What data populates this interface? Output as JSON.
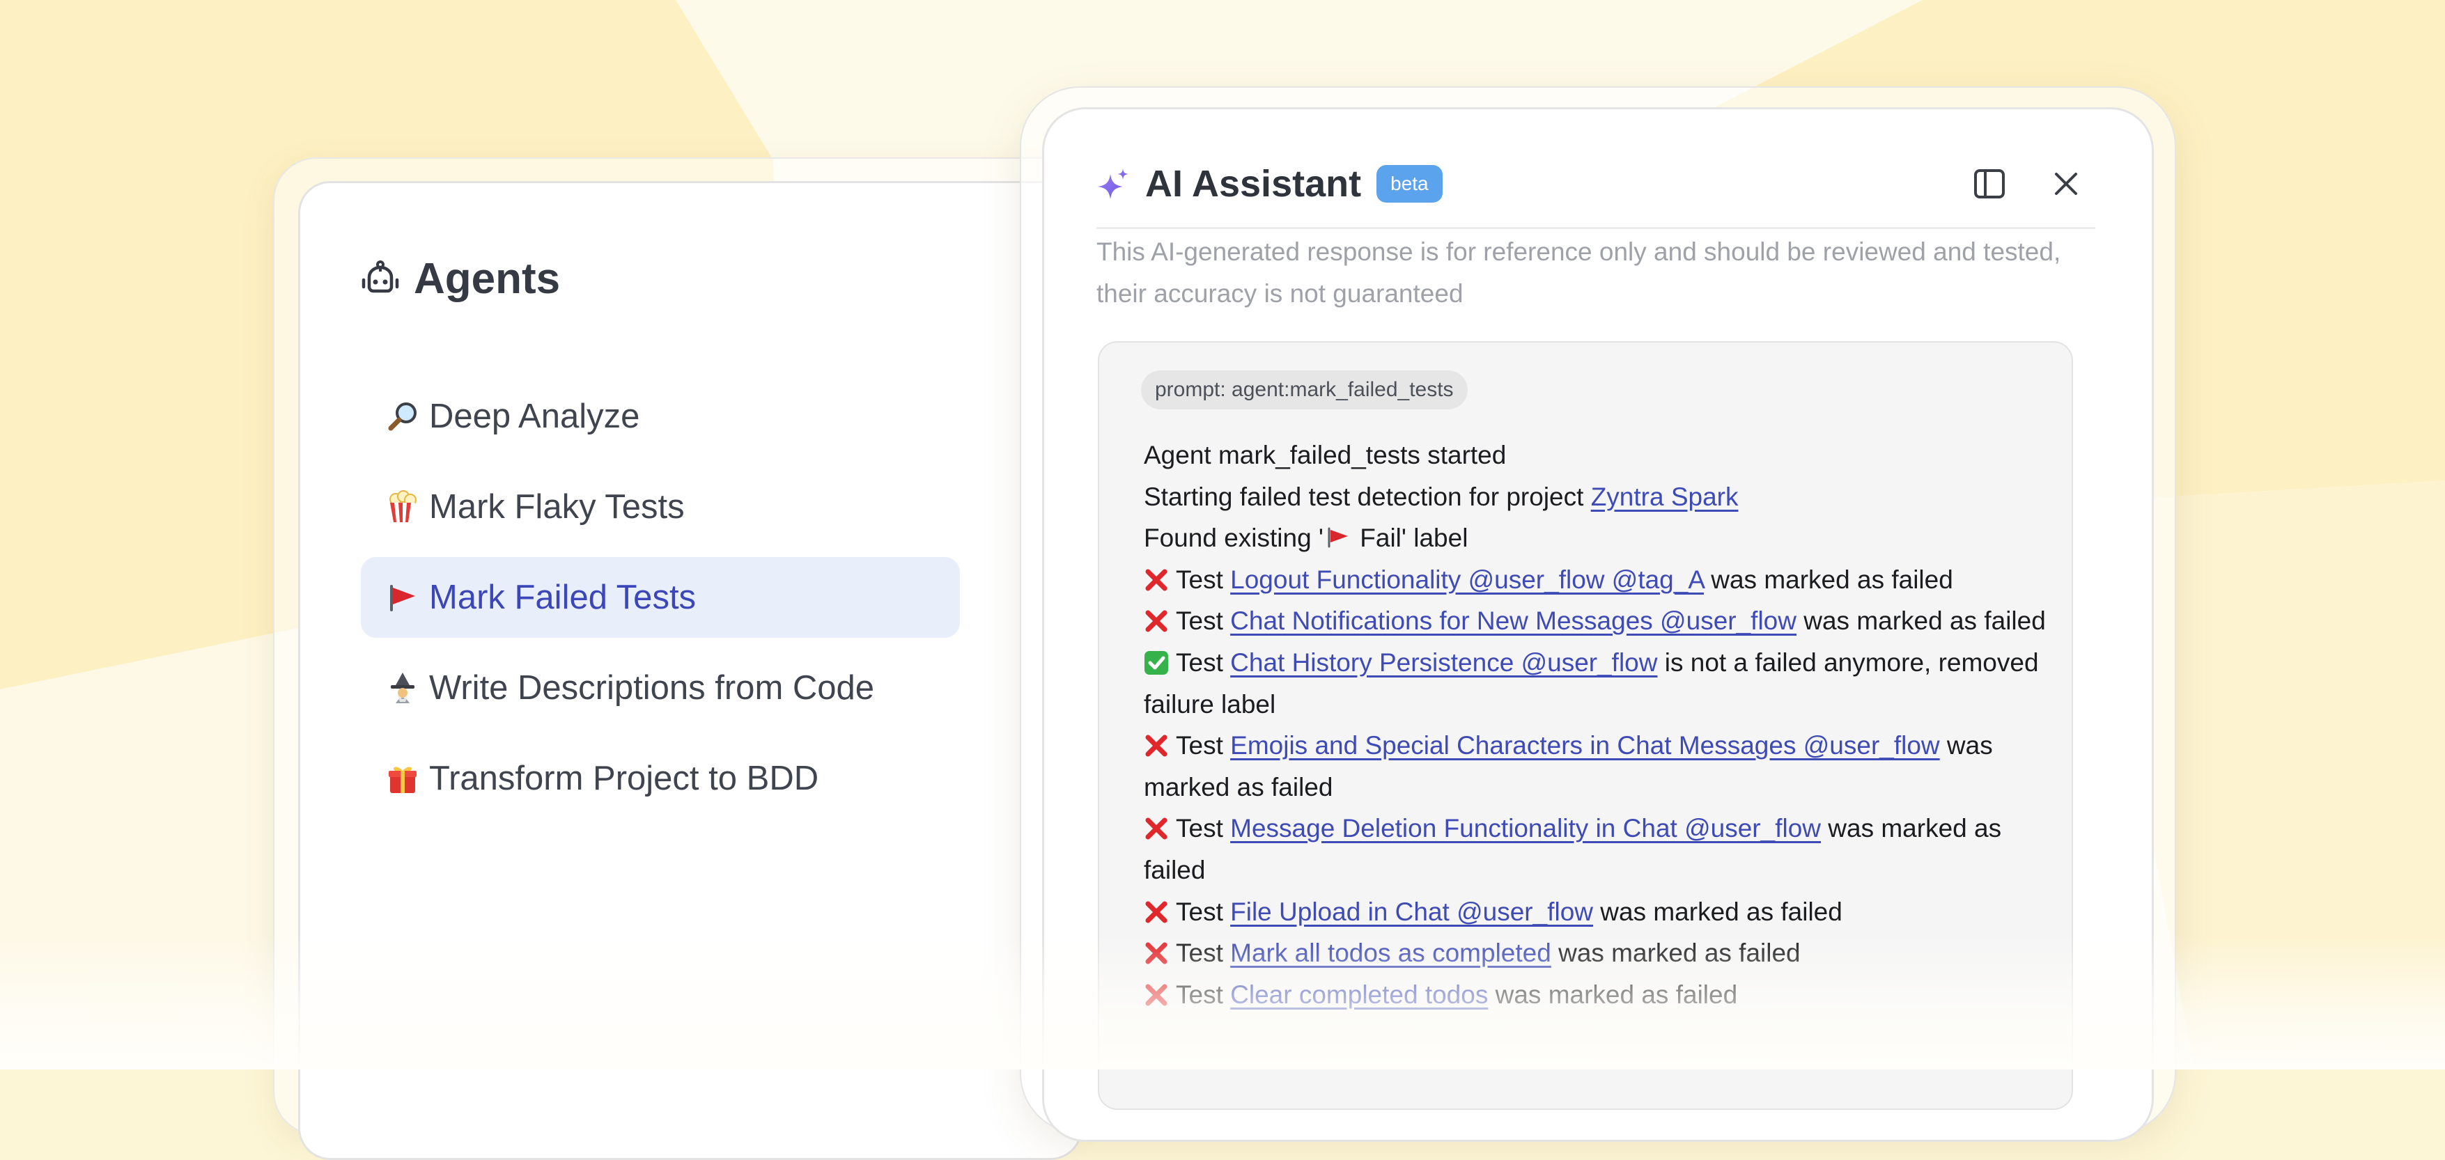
{
  "agents_panel": {
    "title": "Agents",
    "title_icon": "robot-icon",
    "items": [
      {
        "icon": "magnifier-icon",
        "label": "Deep Analyze",
        "active": false
      },
      {
        "icon": "popcorn-icon",
        "label": "Mark Flaky Tests",
        "active": false
      },
      {
        "icon": "red-flag-icon",
        "label": "Mark Failed Tests",
        "active": true
      },
      {
        "icon": "wizard-icon",
        "label": "Write Descriptions from Code",
        "active": false
      },
      {
        "icon": "gift-icon",
        "label": "Transform Project to BDD",
        "active": false
      }
    ]
  },
  "assistant": {
    "title": "AI Assistant",
    "badge": "beta",
    "title_icon": "sparkle-icon",
    "sidebar_toggle_icon": "sidebar-toggle-icon",
    "close_icon": "close-icon",
    "disclaimer": "This AI-generated response is for reference only and should be reviewed and tested, their accuracy is not guaranteed",
    "prompt_chip": "prompt: agent:mark_failed_tests",
    "log": {
      "started": "Agent mark_failed_tests started",
      "detection_prefix": "Starting failed test detection for project ",
      "project_link": "Zyntra Spark",
      "found_prefix": "Found existing '",
      "found_suffix": " Fail' label",
      "entries": [
        {
          "status": "failed",
          "prefix": "Test ",
          "link": "Logout Functionality @user_flow @tag_A",
          "suffix": " was marked as failed"
        },
        {
          "status": "failed",
          "prefix": "Test ",
          "link": "Chat Notifications for New Messages @user_flow",
          "suffix": " was marked as failed"
        },
        {
          "status": "passed",
          "prefix": "Test ",
          "link": "Chat History Persistence @user_flow",
          "suffix": " is not a failed anymore, removed failure label"
        },
        {
          "status": "failed",
          "prefix": "Test ",
          "link": "Emojis and Special Characters in Chat Messages @user_flow",
          "suffix": " was marked as failed"
        },
        {
          "status": "failed",
          "prefix": "Test ",
          "link": "Message Deletion Functionality in Chat @user_flow",
          "suffix": " was marked as failed"
        },
        {
          "status": "failed",
          "prefix": "Test ",
          "link": "File Upload in Chat @user_flow",
          "suffix": " was marked as failed"
        },
        {
          "status": "failed",
          "prefix": "Test ",
          "link": "Mark all todos as completed",
          "suffix": " was marked as failed"
        },
        {
          "status": "failed",
          "prefix": "Test ",
          "link": "Clear completed todos",
          "suffix": " was marked as failed"
        }
      ]
    }
  },
  "colors": {
    "background": "#fdf6d6",
    "active_item_bg": "#e9eefb",
    "link": "#3e4bb6",
    "beta_badge": "#5ba3ec",
    "failed_icon": "#e0272b",
    "passed_icon": "#35b24a"
  }
}
